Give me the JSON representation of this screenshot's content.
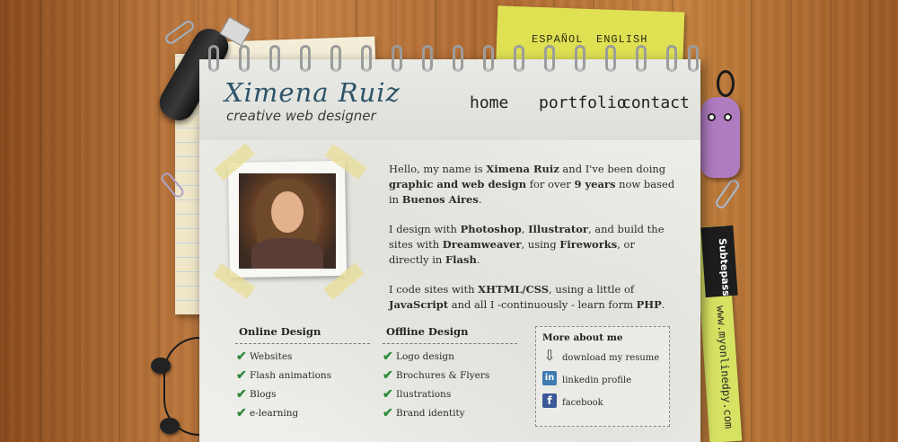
{
  "languages": {
    "es": "ESPAÑOL",
    "en": "ENGLISH"
  },
  "brand": {
    "name": "Ximena Ruiz",
    "tagline": "creative web designer"
  },
  "nav": {
    "home": "home",
    "portfolio": "portfolio",
    "contact": "contact"
  },
  "intro": {
    "p1": {
      "a": "Hello, my name is ",
      "b": "Ximena Ruiz",
      "c": " and I've been doing ",
      "d": "graphic and web design",
      "e": " for over ",
      "f": "9 years",
      "g": " now based in ",
      "h": "Buenos Aires",
      "i": "."
    },
    "p2": {
      "a": "I design with ",
      "b": "Photoshop",
      "c": ", ",
      "d": "Illustrator",
      "e": ", and build the sites with ",
      "f": "Dreamweaver",
      "g": ", using ",
      "h": "Fireworks",
      "i": ", or directly in ",
      "j": "Flash",
      "k": "."
    },
    "p3": {
      "a": "I code sites with ",
      "b": "XHTML/CSS",
      "c": ", using a little of ",
      "d": "JavaScript",
      "e": " and all I -continuously - learn form ",
      "f": "PHP",
      "g": "."
    }
  },
  "online": {
    "title": "Online Design",
    "items": [
      "Websites",
      "Flash animations",
      "Blogs",
      "e-learning"
    ]
  },
  "offline": {
    "title": "Offline Design",
    "items": [
      "Logo design",
      "Brochures & Flyers",
      "Ilustrations",
      "Brand identity"
    ]
  },
  "more": {
    "title": "More about me",
    "links": [
      "download my resume",
      "linkedin profile",
      "facebook"
    ],
    "icons": [
      "download-icon",
      "linkedin-icon",
      "facebook-icon"
    ]
  },
  "pass": {
    "brand": "Subtepass",
    "url": "www.myonlinedpy.com"
  },
  "colors": {
    "brand": "#2e5468",
    "check": "#2e8a3c",
    "note": "#dfe153",
    "linkedin": "#3e7bb3",
    "facebook": "#3b5998"
  }
}
